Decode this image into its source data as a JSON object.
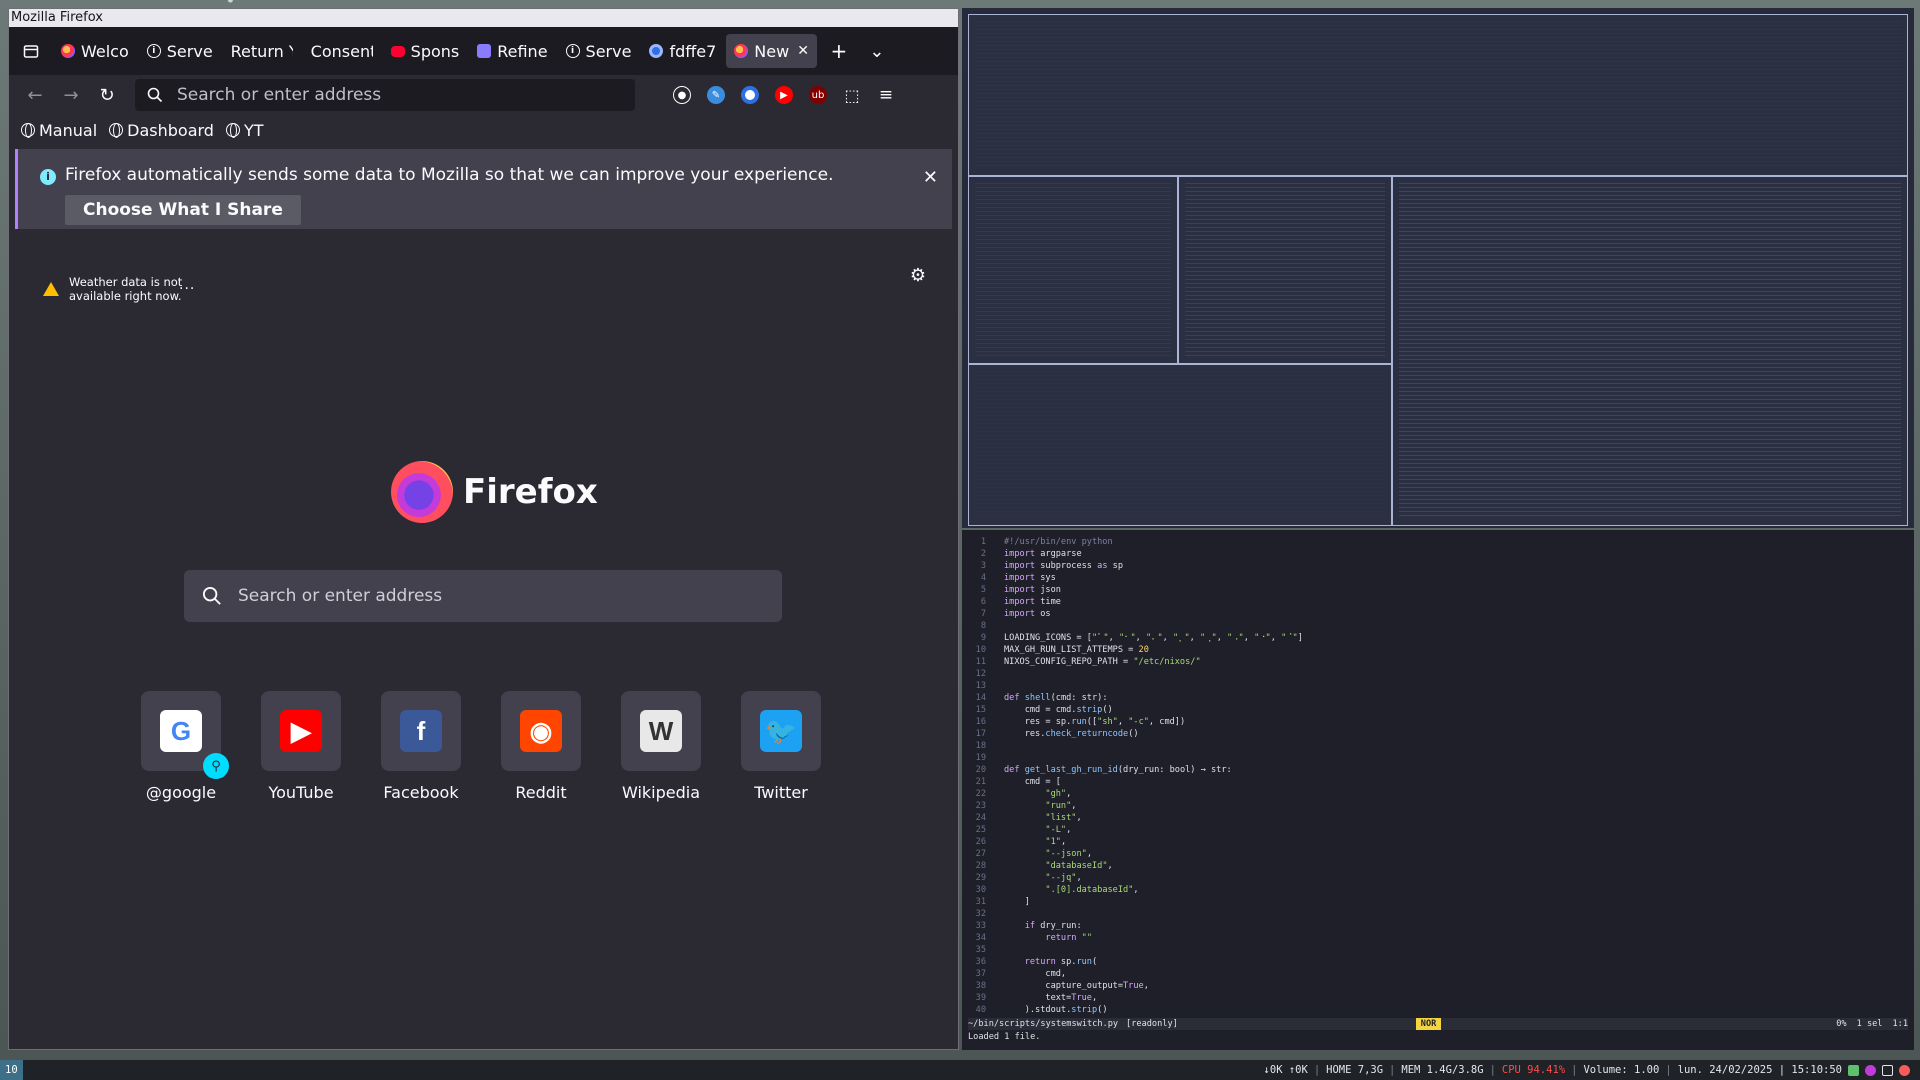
{
  "firefox": {
    "window_title": "Mozilla Firefox",
    "tabs": [
      {
        "label": "Welco",
        "favicon": "firefox-icon",
        "selected": false
      },
      {
        "label": "Serve",
        "favicon": "info-icon",
        "selected": false
      },
      {
        "label": "Return Yo",
        "favicon": "none",
        "selected": false
      },
      {
        "label": "Consent",
        "favicon": "none",
        "selected": false
      },
      {
        "label": "Spons",
        "favicon": "youtube-icon",
        "selected": false
      },
      {
        "label": "Refine",
        "favicon": "refine-icon",
        "selected": false
      },
      {
        "label": "Serve",
        "favicon": "info-icon",
        "selected": false
      },
      {
        "label": "fdffe7",
        "favicon": "blue-circle-icon",
        "selected": false
      },
      {
        "label": "New",
        "favicon": "firefox-icon",
        "selected": true
      }
    ],
    "new_tab_symbol": "+",
    "list_tabs_symbol": "⌄",
    "urlbar_placeholder": "Search or enter address",
    "bookmarks": [
      {
        "label": "Manual"
      },
      {
        "label": "Dashboard"
      },
      {
        "label": "YT"
      }
    ],
    "notification": {
      "text": "Firefox automatically sends some data to Mozilla so that we can improve your experience.",
      "button": "Choose What I Share"
    },
    "newtab": {
      "weather_text": "Weather data is not available right now.",
      "weather_more": "...",
      "logo_word": "Firefox",
      "search_placeholder": "Search or enter address",
      "top_sites": [
        {
          "label": "@google",
          "icon": "google-icon",
          "color": "#ffffff",
          "letter": "G",
          "pinned": true
        },
        {
          "label": "YouTube",
          "icon": "youtube-icon",
          "color": "#ff0000",
          "letter": "▶"
        },
        {
          "label": "Facebook",
          "icon": "facebook-icon",
          "color": "#3b5998",
          "letter": "f"
        },
        {
          "label": "Reddit",
          "icon": "reddit-icon",
          "color": "#ff4500",
          "letter": "◉"
        },
        {
          "label": "Wikipedia",
          "icon": "wikipedia-icon",
          "color": "#e8e8e8",
          "letter": "W"
        },
        {
          "label": "Twitter",
          "icon": "twitter-icon",
          "color": "#1da1f2",
          "letter": "🐦"
        }
      ]
    }
  },
  "editor": {
    "lines": [
      {
        "n": "1",
        "html": "<span class='cm'>#!/usr/bin/env python</span>"
      },
      {
        "n": "2",
        "html": "<span class='kw'>import</span> argparse"
      },
      {
        "n": "3",
        "html": "<span class='kw'>import</span> subprocess <span class='kw'>as</span> sp"
      },
      {
        "n": "4",
        "html": "<span class='kw'>import</span> sys"
      },
      {
        "n": "5",
        "html": "<span class='kw'>import</span> json"
      },
      {
        "n": "6",
        "html": "<span class='kw'>import</span> time"
      },
      {
        "n": "7",
        "html": "<span class='kw'>import</span> os"
      },
      {
        "n": "8",
        "html": ""
      },
      {
        "n": "9",
        "html": "LOADING_ICONS = [<span class='str'>\"⠁\"</span>, <span class='str'>\"⠂\"</span>, <span class='str'>\"⠄\"</span>, <span class='str'>\"⡀\"</span>, <span class='str'>\"⢀\"</span>, <span class='str'>\"⠠\"</span>, <span class='str'>\"⠐\"</span>, <span class='str'>\"⠈\"</span>]"
      },
      {
        "n": "10",
        "html": "MAX_GH_RUN_LIST_ATTEMPS = <span class='num'>20</span>"
      },
      {
        "n": "11",
        "html": "NIXOS_CONFIG_REPO_PATH = <span class='str'>\"/etc/nixos/\"</span>"
      },
      {
        "n": "12",
        "html": ""
      },
      {
        "n": "13",
        "html": ""
      },
      {
        "n": "14",
        "html": "<span class='kw'>def</span> <span class='fn'>shell</span>(cmd: str):"
      },
      {
        "n": "15",
        "html": "    cmd = cmd.<span class='fn'>strip</span>()"
      },
      {
        "n": "16",
        "html": "    res = sp.<span class='fn'>run</span>([<span class='str'>\"sh\"</span>, <span class='str'>\"-c\"</span>, cmd])"
      },
      {
        "n": "17",
        "html": "    res.<span class='fn'>check_returncode</span>()"
      },
      {
        "n": "18",
        "html": ""
      },
      {
        "n": "19",
        "html": ""
      },
      {
        "n": "20",
        "html": "<span class='kw'>def</span> <span class='fn'>get_last_gh_run_id</span>(dry_run: bool) → str:"
      },
      {
        "n": "21",
        "html": "    cmd = ["
      },
      {
        "n": "22",
        "html": "        <span class='str'>\"gh\"</span>,"
      },
      {
        "n": "23",
        "html": "        <span class='str'>\"run\"</span>,"
      },
      {
        "n": "24",
        "html": "        <span class='str'>\"list\"</span>,"
      },
      {
        "n": "25",
        "html": "        <span class='str'>\"-L\"</span>,"
      },
      {
        "n": "26",
        "html": "        <span class='str'>\"1\"</span>,"
      },
      {
        "n": "27",
        "html": "        <span class='str'>\"--json\"</span>,"
      },
      {
        "n": "28",
        "html": "        <span class='str'>\"databaseId\"</span>,"
      },
      {
        "n": "29",
        "html": "        <span class='str'>\"--jq\"</span>,"
      },
      {
        "n": "30",
        "html": "        <span class='str'>\".[0].databaseId\"</span>,"
      },
      {
        "n": "31",
        "html": "    ]"
      },
      {
        "n": "32",
        "html": ""
      },
      {
        "n": "33",
        "html": "    <span class='kw'>if</span> dry_run:"
      },
      {
        "n": "34",
        "html": "        <span class='kw'>return</span> <span class='str'>\"\"</span>"
      },
      {
        "n": "35",
        "html": ""
      },
      {
        "n": "36",
        "html": "    <span class='kw'>return</span> sp.<span class='fn'>run</span>("
      },
      {
        "n": "37",
        "html": "        cmd,"
      },
      {
        "n": "38",
        "html": "        capture_output=<span class='kw'>True</span>,"
      },
      {
        "n": "39",
        "html": "        text=<span class='kw'>True</span>,"
      },
      {
        "n": "40",
        "html": "    ).stdout.<span class='fn'>strip</span>()"
      }
    ],
    "status_file": "~/bin/scripts/systemswitch.py",
    "status_readonly": "[readonly]",
    "status_mode": "NOR",
    "status_percent": "0%",
    "status_sel": "1 sel",
    "status_pos": "1:1",
    "message": "Loaded 1 file."
  },
  "bar": {
    "workspace": "10",
    "net": "↓0K ↑0K",
    "home": "HOME 7,3G",
    "mem": "MEM 1.4G/3.8G",
    "cpu": "CPU 94.41%",
    "volume": "Volume: 1.00",
    "datetime": "lun. 24/02/2025 | 15:10:50"
  }
}
